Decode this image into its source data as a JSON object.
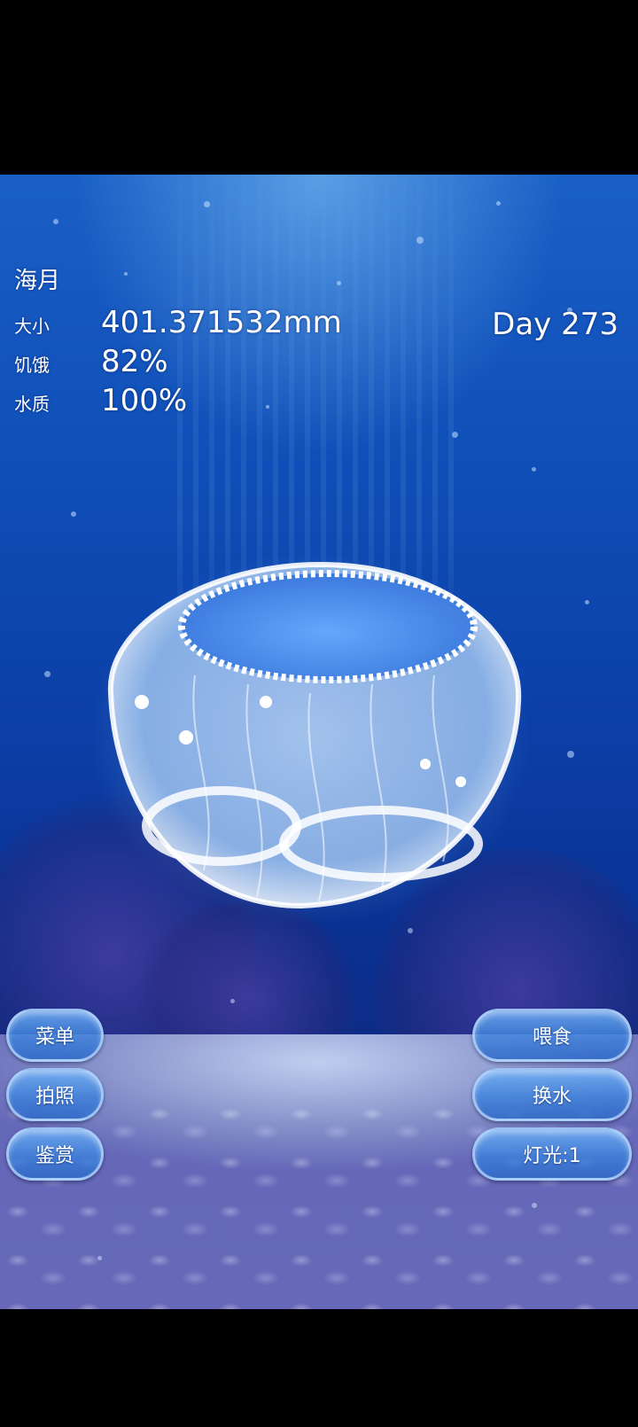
{
  "hud": {
    "title": "海月",
    "stats": [
      {
        "label": "大小",
        "value": "401.371532mm"
      },
      {
        "label": "饥饿",
        "value": "82%"
      },
      {
        "label": "水质",
        "value": "100%"
      }
    ],
    "day": "Day 273"
  },
  "buttons": {
    "left": [
      {
        "label": "菜单"
      },
      {
        "label": "拍照"
      },
      {
        "label": "鉴赏"
      }
    ],
    "right": [
      {
        "label": "喂食"
      },
      {
        "label": "换水"
      },
      {
        "label": "灯光:1"
      }
    ]
  },
  "scene": {
    "creature": "moon-jellyfish",
    "background": "underwater-coral-reef",
    "colors": {
      "water_top": "#1a5fc6",
      "water_bottom": "#0a2f8f",
      "sand": "#c8d7f5",
      "button": "#4f96e0"
    }
  }
}
